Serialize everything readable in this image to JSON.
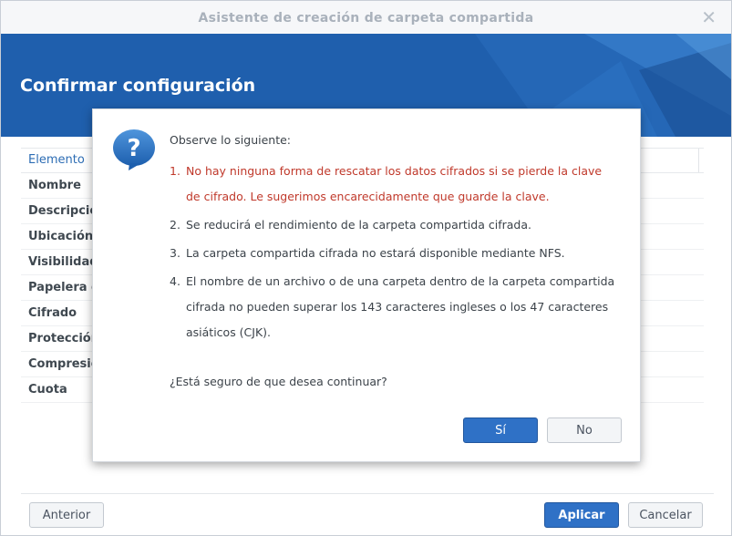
{
  "window": {
    "title": "Asistente de creación de carpeta compartida",
    "close_glyph": "✕"
  },
  "banner": {
    "title": "Confirmar configuración"
  },
  "table": {
    "header": "Elemento",
    "rows": [
      "Nombre",
      "Descripció",
      "Ubicación",
      "Visibilidad",
      "Papelera d",
      "Cifrado",
      "Protección",
      "Compresió",
      "Cuota"
    ]
  },
  "footer": {
    "back_label": "Anterior",
    "apply_label": "Aplicar",
    "cancel_label": "Cancelar"
  },
  "dialog": {
    "icon": "question-icon",
    "intro": "Observe lo siguiente:",
    "items": [
      {
        "num": "1.",
        "text": "No hay ninguna forma de rescatar los datos cifrados si se pierde la clave de cifrado. Le sugerimos encarecidamente que guarde la clave."
      },
      {
        "num": "2.",
        "text": "Se reducirá el rendimiento de la carpeta compartida cifrada."
      },
      {
        "num": "3.",
        "text": "La carpeta compartida cifrada no estará disponible mediante NFS."
      },
      {
        "num": "4.",
        "text": "El nombre de un archivo o de una carpeta dentro de la carpeta compartida cifrada no pueden superar los 143 caracteres ingleses o los 47 caracteres asiáticos (CJK)."
      }
    ],
    "question": "¿Está seguro de que desea continuar?",
    "yes_label": "Sí",
    "no_label": "No"
  },
  "colors": {
    "banner": "#1f5fad",
    "primary_button": "#2f71c6",
    "warning_text": "#c0392b",
    "header_link": "#2d6db4"
  }
}
